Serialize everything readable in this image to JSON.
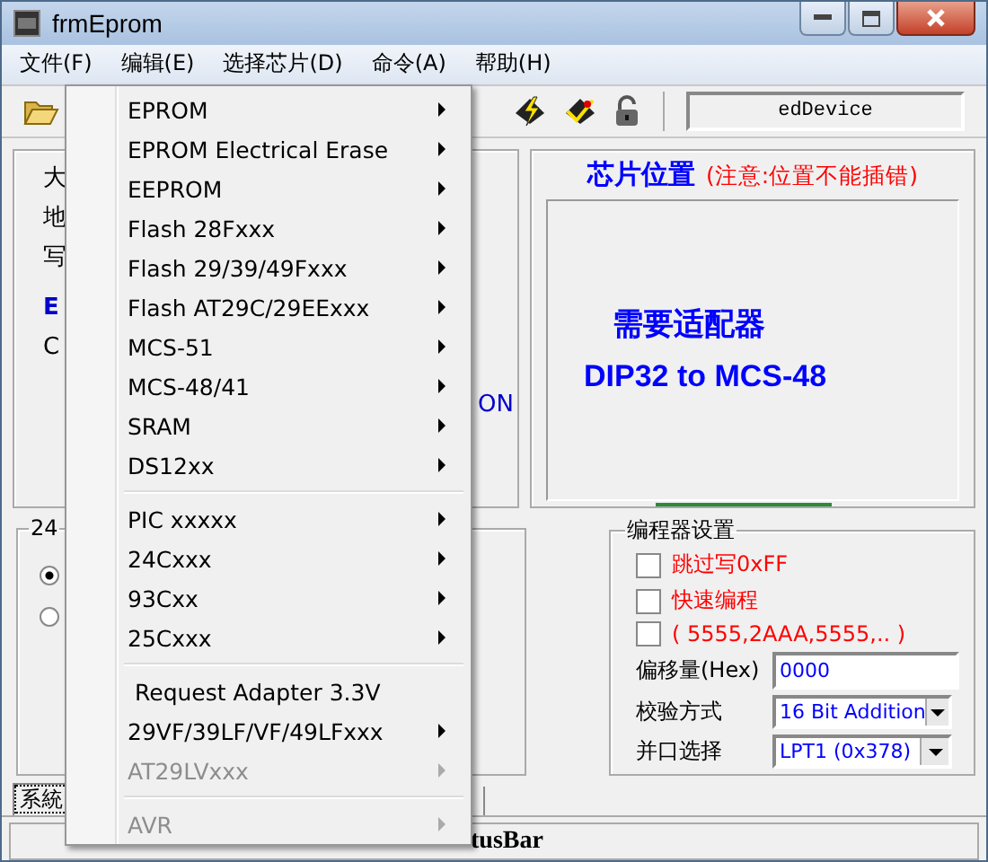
{
  "window": {
    "title": "frmEprom"
  },
  "menubar": [
    {
      "label": "文件(F)"
    },
    {
      "label": "编辑(E)"
    },
    {
      "label": "选择芯片(D)"
    },
    {
      "label": "命令(A)"
    },
    {
      "label": "帮助(H)"
    }
  ],
  "toolbar": {
    "device_field": "edDevice"
  },
  "left_panel": {
    "fragments": [
      {
        "text": "大",
        "kind": "plain"
      },
      {
        "text": "地",
        "kind": "plain"
      },
      {
        "text": "写",
        "kind": "plain"
      },
      {
        "text": "E",
        "kind": "blue"
      },
      {
        "text": "C",
        "kind": "plain"
      }
    ],
    "right_text": "ON"
  },
  "chip_panel": {
    "title": "芯片位置",
    "warning": "(注意:位置不能插错)",
    "line_1": "需要适配器",
    "line_2": "DIP32 to MCS-48"
  },
  "group_24c": {
    "label": "24",
    "radios": [
      {
        "selected": true
      },
      {
        "selected": false
      }
    ]
  },
  "programmer_settings": {
    "title": "编程器设置",
    "checkboxes": [
      {
        "label": "跳过写0xFF",
        "checked": false
      },
      {
        "label": "快速编程",
        "checked": false
      },
      {
        "label": "( 5555,2AAA,5555,.. )",
        "checked": false
      }
    ],
    "offset_label": "偏移量(Hex)",
    "offset_value": "0000",
    "verify_label": "校验方式",
    "verify_value": "16 Bit Addition",
    "port_label": "并口选择",
    "port_value": "LPT1 (0x378)"
  },
  "tabs": [
    {
      "label": "系統",
      "selected": true
    }
  ],
  "status_bar": "tusBar",
  "dropdown_menu": [
    {
      "kind": "submenu",
      "label": "EPROM",
      "disabled": false
    },
    {
      "kind": "submenu",
      "label": "EPROM Electrical Erase",
      "disabled": false
    },
    {
      "kind": "submenu",
      "label": "EEPROM",
      "disabled": false
    },
    {
      "kind": "submenu",
      "label": "Flash 28Fxxx",
      "disabled": false
    },
    {
      "kind": "submenu",
      "label": "Flash 29/39/49Fxxx",
      "disabled": false
    },
    {
      "kind": "submenu",
      "label": "Flash  AT29C/29EExxx",
      "disabled": false
    },
    {
      "kind": "submenu",
      "label": "MCS-51",
      "disabled": false
    },
    {
      "kind": "submenu",
      "label": "MCS-48/41",
      "disabled": false
    },
    {
      "kind": "submenu",
      "label": "SRAM",
      "disabled": false
    },
    {
      "kind": "submenu",
      "label": "DS12xx",
      "disabled": false
    },
    {
      "kind": "separator"
    },
    {
      "kind": "submenu",
      "label": "PIC xxxxx",
      "disabled": false
    },
    {
      "kind": "submenu",
      "label": "24Cxxx",
      "disabled": false
    },
    {
      "kind": "submenu",
      "label": "93Cxx",
      "disabled": false
    },
    {
      "kind": "submenu",
      "label": "25Cxxx",
      "disabled": false
    },
    {
      "kind": "separator"
    },
    {
      "kind": "command",
      "label": "Request Adapter 3.3V",
      "disabled": false
    },
    {
      "kind": "submenu",
      "label": "29VF/39LF/VF/49LFxxx",
      "disabled": false
    },
    {
      "kind": "submenu",
      "label": "AT29LVxxx",
      "disabled": true
    },
    {
      "kind": "separator"
    },
    {
      "kind": "submenu",
      "label": "AVR",
      "disabled": true
    }
  ]
}
